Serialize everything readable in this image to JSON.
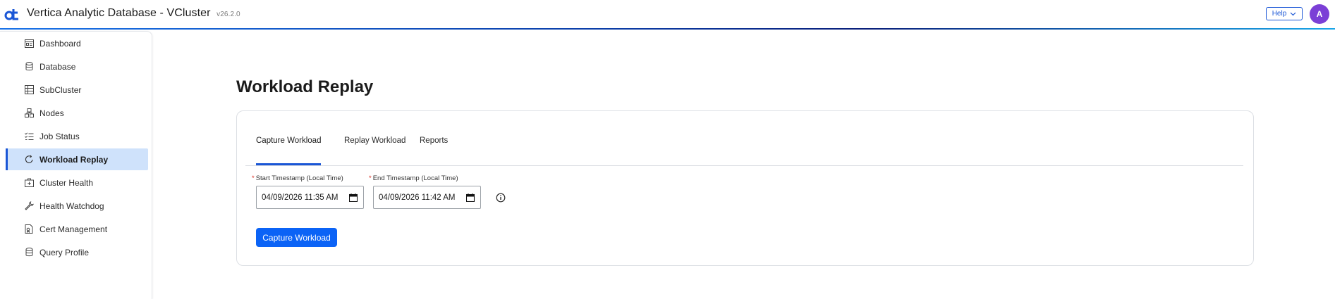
{
  "header": {
    "title": "Vertica Analytic Database - VCluster",
    "version": "v26.2.0",
    "help_label": "Help",
    "avatar_initial": "A",
    "accent": "#1a56d6",
    "avatar_color": "#7b3fd6"
  },
  "sidebar": {
    "items": [
      {
        "label": "Dashboard",
        "icon": "dashboard-icon"
      },
      {
        "label": "Database",
        "icon": "database-icon"
      },
      {
        "label": "SubCluster",
        "icon": "subcluster-icon"
      },
      {
        "label": "Nodes",
        "icon": "nodes-icon"
      },
      {
        "label": "Job Status",
        "icon": "job-status-icon"
      },
      {
        "label": "Workload Replay",
        "icon": "replay-icon",
        "active": true
      },
      {
        "label": "Cluster Health",
        "icon": "cluster-health-icon"
      },
      {
        "label": "Health Watchdog",
        "icon": "wrench-icon"
      },
      {
        "label": "Cert Management",
        "icon": "certificate-icon"
      },
      {
        "label": "Query Profile",
        "icon": "query-profile-icon"
      }
    ]
  },
  "main": {
    "title": "Workload Replay",
    "tabs": [
      {
        "label": "Capture Workload",
        "active": true
      },
      {
        "label": "Replay Workload"
      },
      {
        "label": "Reports"
      }
    ],
    "form": {
      "start_label": "Start Timestamp (Local Time)",
      "start_value": "04/09/2026 11:35 AM",
      "end_label": "End Timestamp (Local Time)",
      "end_value": "04/09/2026 11:42 AM",
      "required_mark": "*",
      "submit_label": "Capture Workload"
    }
  }
}
